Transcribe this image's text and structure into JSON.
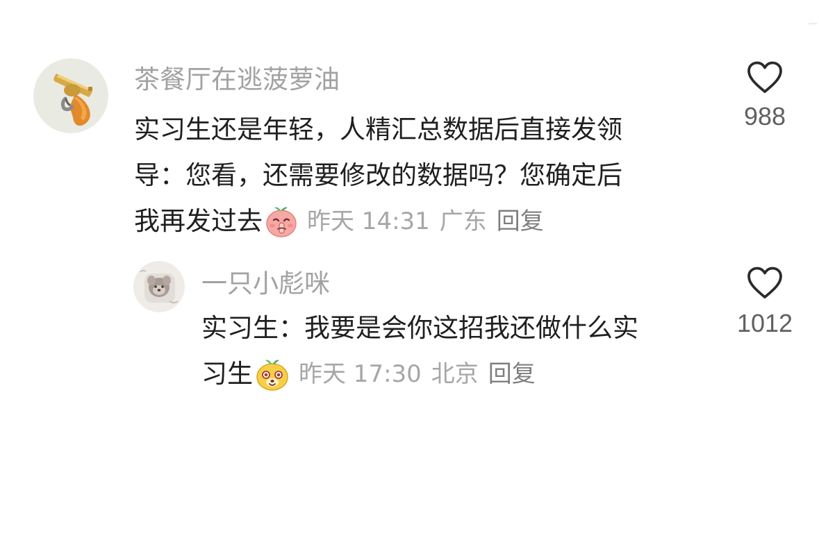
{
  "comment": {
    "username": "茶餐厅在逃菠萝油",
    "avatar_icon": "golden-revolver-icon",
    "text_lines": [
      "实习生还是年轻，人精汇总数据后直接发领",
      "导：您看，还需要修改的数据吗？您确定后",
      "我再发过去"
    ],
    "emoji": "shush-face-emoji",
    "time": "昨天 14:31",
    "location": "广东",
    "reply_label": "回复",
    "like_icon": "heart-outline-icon",
    "like_count": "988"
  },
  "reply": {
    "username": "一只小彪咪",
    "avatar_icon": "plush-toy-avatar",
    "text_lines": [
      "实习生：我要是会你这招我还做什么实",
      "习生"
    ],
    "emoji": "surprised-bear-emoji",
    "time": "昨天 17:30",
    "location": "北京",
    "reply_label": "回复",
    "like_icon": "heart-outline-icon",
    "like_count": "1012"
  },
  "colors": {
    "username": "#a2a2a2",
    "body": "#1f1f1f",
    "meta": "#a6a6a6",
    "like_icon": "#2b2b2b"
  }
}
